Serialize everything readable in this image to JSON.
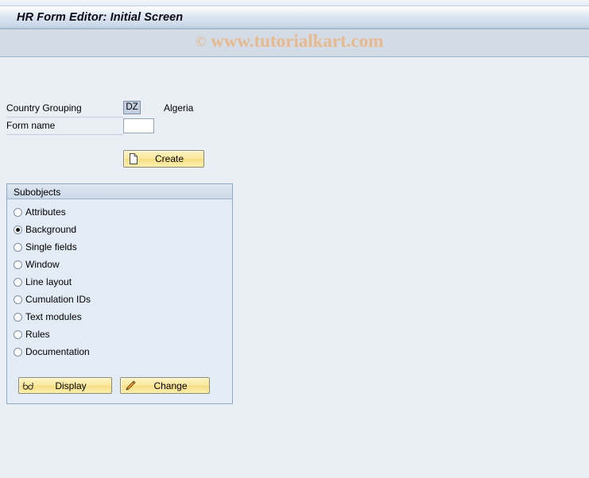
{
  "window": {
    "title": "HR Form Editor: Initial Screen"
  },
  "watermark": {
    "symbol": "©",
    "text": "www.tutorialkart.com"
  },
  "form": {
    "country_grouping": {
      "label": "Country Grouping",
      "value": "DZ",
      "description": "Algeria"
    },
    "form_name": {
      "label": "Form name",
      "value": "",
      "placeholder": ""
    }
  },
  "toolbar": {
    "create_label": "Create",
    "create_icon": "new-document-icon"
  },
  "subobjects": {
    "title": "Subobjects",
    "selected": "Background",
    "options": [
      {
        "label": "Attributes",
        "selected": false
      },
      {
        "label": "Background",
        "selected": true
      },
      {
        "label": "Single fields",
        "selected": false
      },
      {
        "label": "Window",
        "selected": false
      },
      {
        "label": "Line layout",
        "selected": false
      },
      {
        "label": "Cumulation IDs",
        "selected": false
      },
      {
        "label": "Text modules",
        "selected": false
      },
      {
        "label": "Rules",
        "selected": false
      },
      {
        "label": "Documentation",
        "selected": false
      }
    ],
    "actions": {
      "display_label": "Display",
      "display_icon": "glasses-icon",
      "change_label": "Change",
      "change_icon": "pencil-icon"
    }
  },
  "colors": {
    "title_bar_accent": "#c6d5e6",
    "page_background": "#eaeff6",
    "button_yellow": "#fbe9a0",
    "watermark": "#e8b98c",
    "group_border": "#8fa9c4"
  }
}
